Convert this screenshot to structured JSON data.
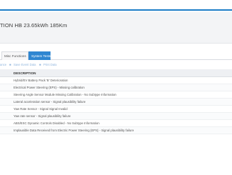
{
  "vehicle": {
    "title": "TION HB 23.65kWh 185Km"
  },
  "tabs": [
    {
      "label": "Misc Functions",
      "active": false
    },
    {
      "label": "System Tests",
      "active": true
    }
  ],
  "toolbar": {
    "items": [
      "ance",
      "Save Event Data",
      "Print Data"
    ]
  },
  "table": {
    "header": "DESCRIPTION",
    "rows": [
      "Hybrid/EV Battery Pack 'B' Deterioration",
      "Electrical Power Steering (EPS) - Missing calibration",
      "Steering Angle Sensor Module Missing Calibration - No Subtype Information",
      "Lateral acceleration sensor - Signal plausibility failure",
      "Yaw Rate Sensor - Signal Signal Invalid",
      "Yaw rate sensor - Signal plausibility failure",
      "ABS/ESC Dynamic Controls Disabled - No Subtype Information",
      "Implausible Data Received from Electric Power Steering (EPS) - Signal plausibility failure"
    ]
  },
  "colors": {
    "accent": "#1e7ec8",
    "active_tab": "#2f86d1"
  }
}
